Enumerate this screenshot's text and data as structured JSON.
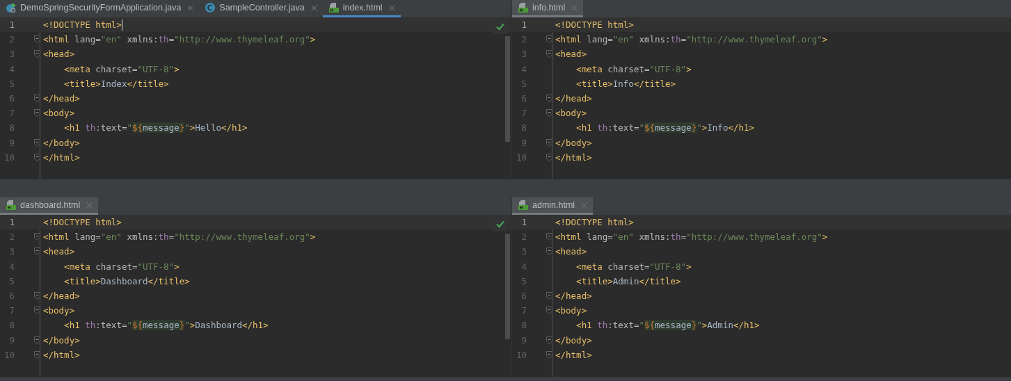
{
  "panes": [
    {
      "active": true,
      "inspection_ok": true,
      "tabs": [
        {
          "label": "DemoSpringSecurityFormApplication.java",
          "kind": "java-run",
          "selected": false
        },
        {
          "label": "SampleController.java",
          "kind": "java-class",
          "selected": false
        },
        {
          "label": "index.html",
          "kind": "html",
          "selected": true
        }
      ],
      "lines": [
        {
          "number": "1",
          "fold": false,
          "current": true,
          "caret": true,
          "tokens": [
            {
              "text": "<!DOCTYPE html>",
              "kind": "tag"
            }
          ]
        },
        {
          "number": "2",
          "fold": true,
          "current": false,
          "caret": false,
          "tokens": [
            {
              "text": "<html",
              "kind": "tag"
            },
            {
              "text": " lang=",
              "kind": "attr"
            },
            {
              "text": "\"en\"",
              "kind": "str"
            },
            {
              "text": " xmlns:",
              "kind": "attr"
            },
            {
              "text": "th",
              "kind": "ns"
            },
            {
              "text": "=",
              "kind": "attr"
            },
            {
              "text": "\"http://www.thymeleaf.org\"",
              "kind": "str"
            },
            {
              "text": ">",
              "kind": "tag"
            }
          ]
        },
        {
          "number": "3",
          "fold": true,
          "current": false,
          "caret": false,
          "tokens": [
            {
              "text": "<head>",
              "kind": "tag"
            }
          ]
        },
        {
          "number": "4",
          "fold": false,
          "current": false,
          "caret": false,
          "tokens": [
            {
              "text": "    <meta",
              "kind": "tag"
            },
            {
              "text": " charset=",
              "kind": "attr"
            },
            {
              "text": "\"UTF-8\"",
              "kind": "str"
            },
            {
              "text": ">",
              "kind": "tag"
            }
          ]
        },
        {
          "number": "5",
          "fold": false,
          "current": false,
          "caret": false,
          "tokens": [
            {
              "text": "    <title>",
              "kind": "tag"
            },
            {
              "text": "Index",
              "kind": "text"
            },
            {
              "text": "</title>",
              "kind": "tag"
            }
          ]
        },
        {
          "number": "6",
          "fold": true,
          "current": false,
          "caret": false,
          "tokens": [
            {
              "text": "</head>",
              "kind": "tag"
            }
          ]
        },
        {
          "number": "7",
          "fold": true,
          "current": false,
          "caret": false,
          "tokens": [
            {
              "text": "<body>",
              "kind": "tag"
            }
          ]
        },
        {
          "number": "8",
          "fold": false,
          "current": false,
          "caret": false,
          "tokens": [
            {
              "text": "    <h1 ",
              "kind": "tag"
            },
            {
              "text": "th",
              "kind": "ns"
            },
            {
              "text": ":text=",
              "kind": "attr"
            },
            {
              "text": "\"",
              "kind": "str"
            },
            {
              "text": "${",
              "kind": "expr"
            },
            {
              "text": "message",
              "kind": "var"
            },
            {
              "text": "}",
              "kind": "expr"
            },
            {
              "text": "\"",
              "kind": "str"
            },
            {
              "text": ">",
              "kind": "tag"
            },
            {
              "text": "Hello",
              "kind": "text"
            },
            {
              "text": "</h1>",
              "kind": "tag"
            }
          ]
        },
        {
          "number": "9",
          "fold": true,
          "current": false,
          "caret": false,
          "tokens": [
            {
              "text": "</body>",
              "kind": "tag"
            }
          ]
        },
        {
          "number": "10",
          "fold": true,
          "current": false,
          "caret": false,
          "tokens": [
            {
              "text": "</html>",
              "kind": "tag"
            }
          ]
        }
      ]
    },
    {
      "active": false,
      "inspection_ok": false,
      "tabs": [
        {
          "label": "info.html",
          "kind": "html",
          "selected": true
        }
      ],
      "lines": [
        {
          "number": "1",
          "fold": false,
          "current": true,
          "caret": false,
          "tokens": [
            {
              "text": "<!DOCTYPE html>",
              "kind": "tag"
            }
          ]
        },
        {
          "number": "2",
          "fold": true,
          "current": false,
          "caret": false,
          "tokens": [
            {
              "text": "<html",
              "kind": "tag"
            },
            {
              "text": " lang=",
              "kind": "attr"
            },
            {
              "text": "\"en\"",
              "kind": "str"
            },
            {
              "text": " xmlns:",
              "kind": "attr"
            },
            {
              "text": "th",
              "kind": "ns"
            },
            {
              "text": "=",
              "kind": "attr"
            },
            {
              "text": "\"http://www.thymeleaf.org\"",
              "kind": "str"
            },
            {
              "text": ">",
              "kind": "tag"
            }
          ]
        },
        {
          "number": "3",
          "fold": true,
          "current": false,
          "caret": false,
          "tokens": [
            {
              "text": "<head>",
              "kind": "tag"
            }
          ]
        },
        {
          "number": "4",
          "fold": false,
          "current": false,
          "caret": false,
          "tokens": [
            {
              "text": "    <meta",
              "kind": "tag"
            },
            {
              "text": " charset=",
              "kind": "attr"
            },
            {
              "text": "\"UTF-8\"",
              "kind": "str"
            },
            {
              "text": ">",
              "kind": "tag"
            }
          ]
        },
        {
          "number": "5",
          "fold": false,
          "current": false,
          "caret": false,
          "tokens": [
            {
              "text": "    <title>",
              "kind": "tag"
            },
            {
              "text": "Info",
              "kind": "text"
            },
            {
              "text": "</title>",
              "kind": "tag"
            }
          ]
        },
        {
          "number": "6",
          "fold": true,
          "current": false,
          "caret": false,
          "tokens": [
            {
              "text": "</head>",
              "kind": "tag"
            }
          ]
        },
        {
          "number": "7",
          "fold": true,
          "current": false,
          "caret": false,
          "tokens": [
            {
              "text": "<body>",
              "kind": "tag"
            }
          ]
        },
        {
          "number": "8",
          "fold": false,
          "current": false,
          "caret": false,
          "tokens": [
            {
              "text": "    <h1 ",
              "kind": "tag"
            },
            {
              "text": "th",
              "kind": "ns"
            },
            {
              "text": ":text=",
              "kind": "attr"
            },
            {
              "text": "\"",
              "kind": "str"
            },
            {
              "text": "${",
              "kind": "expr"
            },
            {
              "text": "message",
              "kind": "var"
            },
            {
              "text": "}",
              "kind": "expr"
            },
            {
              "text": "\"",
              "kind": "str"
            },
            {
              "text": ">",
              "kind": "tag"
            },
            {
              "text": "Info",
              "kind": "text"
            },
            {
              "text": "</h1>",
              "kind": "tag"
            }
          ]
        },
        {
          "number": "9",
          "fold": true,
          "current": false,
          "caret": false,
          "tokens": [
            {
              "text": "</body>",
              "kind": "tag"
            }
          ]
        },
        {
          "number": "10",
          "fold": true,
          "current": false,
          "caret": false,
          "tokens": [
            {
              "text": "</html>",
              "kind": "tag"
            }
          ]
        }
      ]
    },
    {
      "active": false,
      "inspection_ok": true,
      "tabs": [
        {
          "label": "dashboard.html",
          "kind": "html",
          "selected": true
        }
      ],
      "lines": [
        {
          "number": "1",
          "fold": false,
          "current": true,
          "caret": false,
          "tokens": [
            {
              "text": "<!DOCTYPE html>",
              "kind": "tag"
            }
          ]
        },
        {
          "number": "2",
          "fold": true,
          "current": false,
          "caret": false,
          "tokens": [
            {
              "text": "<html",
              "kind": "tag"
            },
            {
              "text": " lang=",
              "kind": "attr"
            },
            {
              "text": "\"en\"",
              "kind": "str"
            },
            {
              "text": " xmlns:",
              "kind": "attr"
            },
            {
              "text": "th",
              "kind": "ns"
            },
            {
              "text": "=",
              "kind": "attr"
            },
            {
              "text": "\"http://www.thymeleaf.org\"",
              "kind": "str"
            },
            {
              "text": ">",
              "kind": "tag"
            }
          ]
        },
        {
          "number": "3",
          "fold": true,
          "current": false,
          "caret": false,
          "tokens": [
            {
              "text": "<head>",
              "kind": "tag"
            }
          ]
        },
        {
          "number": "4",
          "fold": false,
          "current": false,
          "caret": false,
          "tokens": [
            {
              "text": "    <meta",
              "kind": "tag"
            },
            {
              "text": " charset=",
              "kind": "attr"
            },
            {
              "text": "\"UTF-8\"",
              "kind": "str"
            },
            {
              "text": ">",
              "kind": "tag"
            }
          ]
        },
        {
          "number": "5",
          "fold": false,
          "current": false,
          "caret": false,
          "tokens": [
            {
              "text": "    <title>",
              "kind": "tag"
            },
            {
              "text": "Dashboard",
              "kind": "text"
            },
            {
              "text": "</title>",
              "kind": "tag"
            }
          ]
        },
        {
          "number": "6",
          "fold": true,
          "current": false,
          "caret": false,
          "tokens": [
            {
              "text": "</head>",
              "kind": "tag"
            }
          ]
        },
        {
          "number": "7",
          "fold": true,
          "current": false,
          "caret": false,
          "tokens": [
            {
              "text": "<body>",
              "kind": "tag"
            }
          ]
        },
        {
          "number": "8",
          "fold": false,
          "current": false,
          "caret": false,
          "tokens": [
            {
              "text": "    <h1 ",
              "kind": "tag"
            },
            {
              "text": "th",
              "kind": "ns"
            },
            {
              "text": ":text=",
              "kind": "attr"
            },
            {
              "text": "\"",
              "kind": "str"
            },
            {
              "text": "${",
              "kind": "expr"
            },
            {
              "text": "message",
              "kind": "var"
            },
            {
              "text": "}",
              "kind": "expr"
            },
            {
              "text": "\"",
              "kind": "str"
            },
            {
              "text": ">",
              "kind": "tag"
            },
            {
              "text": "Dashboard",
              "kind": "text"
            },
            {
              "text": "</h1>",
              "kind": "tag"
            }
          ]
        },
        {
          "number": "9",
          "fold": true,
          "current": false,
          "caret": false,
          "tokens": [
            {
              "text": "</body>",
              "kind": "tag"
            }
          ]
        },
        {
          "number": "10",
          "fold": true,
          "current": false,
          "caret": false,
          "tokens": [
            {
              "text": "</html>",
              "kind": "tag"
            }
          ]
        }
      ]
    },
    {
      "active": false,
      "inspection_ok": false,
      "tabs": [
        {
          "label": "admin.html",
          "kind": "html",
          "selected": true
        }
      ],
      "lines": [
        {
          "number": "1",
          "fold": false,
          "current": true,
          "caret": false,
          "tokens": [
            {
              "text": "<!DOCTYPE html>",
              "kind": "tag"
            }
          ]
        },
        {
          "number": "2",
          "fold": true,
          "current": false,
          "caret": false,
          "tokens": [
            {
              "text": "<html",
              "kind": "tag"
            },
            {
              "text": " lang=",
              "kind": "attr"
            },
            {
              "text": "\"en\"",
              "kind": "str"
            },
            {
              "text": " xmlns:",
              "kind": "attr"
            },
            {
              "text": "th",
              "kind": "ns"
            },
            {
              "text": "=",
              "kind": "attr"
            },
            {
              "text": "\"http://www.thymeleaf.org\"",
              "kind": "str"
            },
            {
              "text": ">",
              "kind": "tag"
            }
          ]
        },
        {
          "number": "3",
          "fold": true,
          "current": false,
          "caret": false,
          "tokens": [
            {
              "text": "<head>",
              "kind": "tag"
            }
          ]
        },
        {
          "number": "4",
          "fold": false,
          "current": false,
          "caret": false,
          "tokens": [
            {
              "text": "    <meta",
              "kind": "tag"
            },
            {
              "text": " charset=",
              "kind": "attr"
            },
            {
              "text": "\"UTF-8\"",
              "kind": "str"
            },
            {
              "text": ">",
              "kind": "tag"
            }
          ]
        },
        {
          "number": "5",
          "fold": false,
          "current": false,
          "caret": false,
          "tokens": [
            {
              "text": "    <title>",
              "kind": "tag"
            },
            {
              "text": "Admin",
              "kind": "text"
            },
            {
              "text": "</title>",
              "kind": "tag"
            }
          ]
        },
        {
          "number": "6",
          "fold": true,
          "current": false,
          "caret": false,
          "tokens": [
            {
              "text": "</head>",
              "kind": "tag"
            }
          ]
        },
        {
          "number": "7",
          "fold": true,
          "current": false,
          "caret": false,
          "tokens": [
            {
              "text": "<body>",
              "kind": "tag"
            }
          ]
        },
        {
          "number": "8",
          "fold": false,
          "current": false,
          "caret": false,
          "tokens": [
            {
              "text": "    <h1 ",
              "kind": "tag"
            },
            {
              "text": "th",
              "kind": "ns"
            },
            {
              "text": ":text=",
              "kind": "attr"
            },
            {
              "text": "\"",
              "kind": "str"
            },
            {
              "text": "${",
              "kind": "expr"
            },
            {
              "text": "message",
              "kind": "var"
            },
            {
              "text": "}",
              "kind": "expr"
            },
            {
              "text": "\"",
              "kind": "str"
            },
            {
              "text": ">",
              "kind": "tag"
            },
            {
              "text": "Admin",
              "kind": "text"
            },
            {
              "text": "</h1>",
              "kind": "tag"
            }
          ]
        },
        {
          "number": "9",
          "fold": true,
          "current": false,
          "caret": false,
          "tokens": [
            {
              "text": "</body>",
              "kind": "tag"
            }
          ]
        },
        {
          "number": "10",
          "fold": true,
          "current": false,
          "caret": false,
          "tokens": [
            {
              "text": "</html>",
              "kind": "tag"
            }
          ]
        }
      ]
    }
  ]
}
